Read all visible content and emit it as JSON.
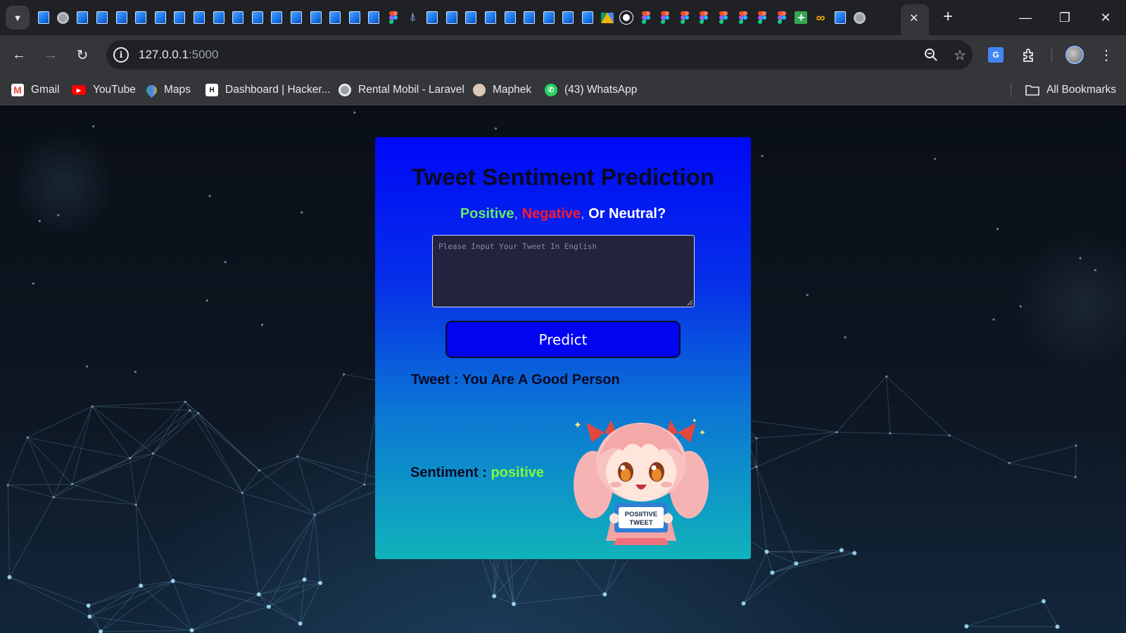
{
  "browser": {
    "url_host": "127.0.0.1",
    "url_port": ":5000",
    "active_tab_close": "✕",
    "new_tab": "+",
    "bookmarks": [
      {
        "label": "Gmail",
        "icon": "gmail-icon"
      },
      {
        "label": "YouTube",
        "icon": "youtube-icon"
      },
      {
        "label": "Maps",
        "icon": "maps-icon"
      },
      {
        "label": "Dashboard | Hacker...",
        "icon": "hackerrank-icon"
      },
      {
        "label": "Rental Mobil - Laravel",
        "icon": "globe-icon"
      },
      {
        "label": "Maphek",
        "icon": "avatar-icon"
      },
      {
        "label": "(43) WhatsApp",
        "icon": "whatsapp-icon"
      }
    ],
    "all_bookmarks": "All Bookmarks"
  },
  "app": {
    "title": "Tweet Sentiment Prediction",
    "subtitle": {
      "positive": "Positive",
      "sep1": ", ",
      "negative": "Negative",
      "sep2": ", ",
      "neutral": "Or Neutral?"
    },
    "input": {
      "placeholder": "Please Input Your Tweet In English",
      "value": ""
    },
    "predict_label": "Predict",
    "result": {
      "tweet_label": "Tweet : ",
      "tweet_text": "You Are A Good Person",
      "sentiment_label": "Sentiment : ",
      "sentiment_value": "positive"
    },
    "mascot_sign": [
      "POSIITIVE",
      "TWEET"
    ]
  },
  "colors": {
    "positive": "#68e86a",
    "negative": "#ff1a2a",
    "sentiment_value": "#7dfa3c",
    "button": "#0004ef"
  }
}
